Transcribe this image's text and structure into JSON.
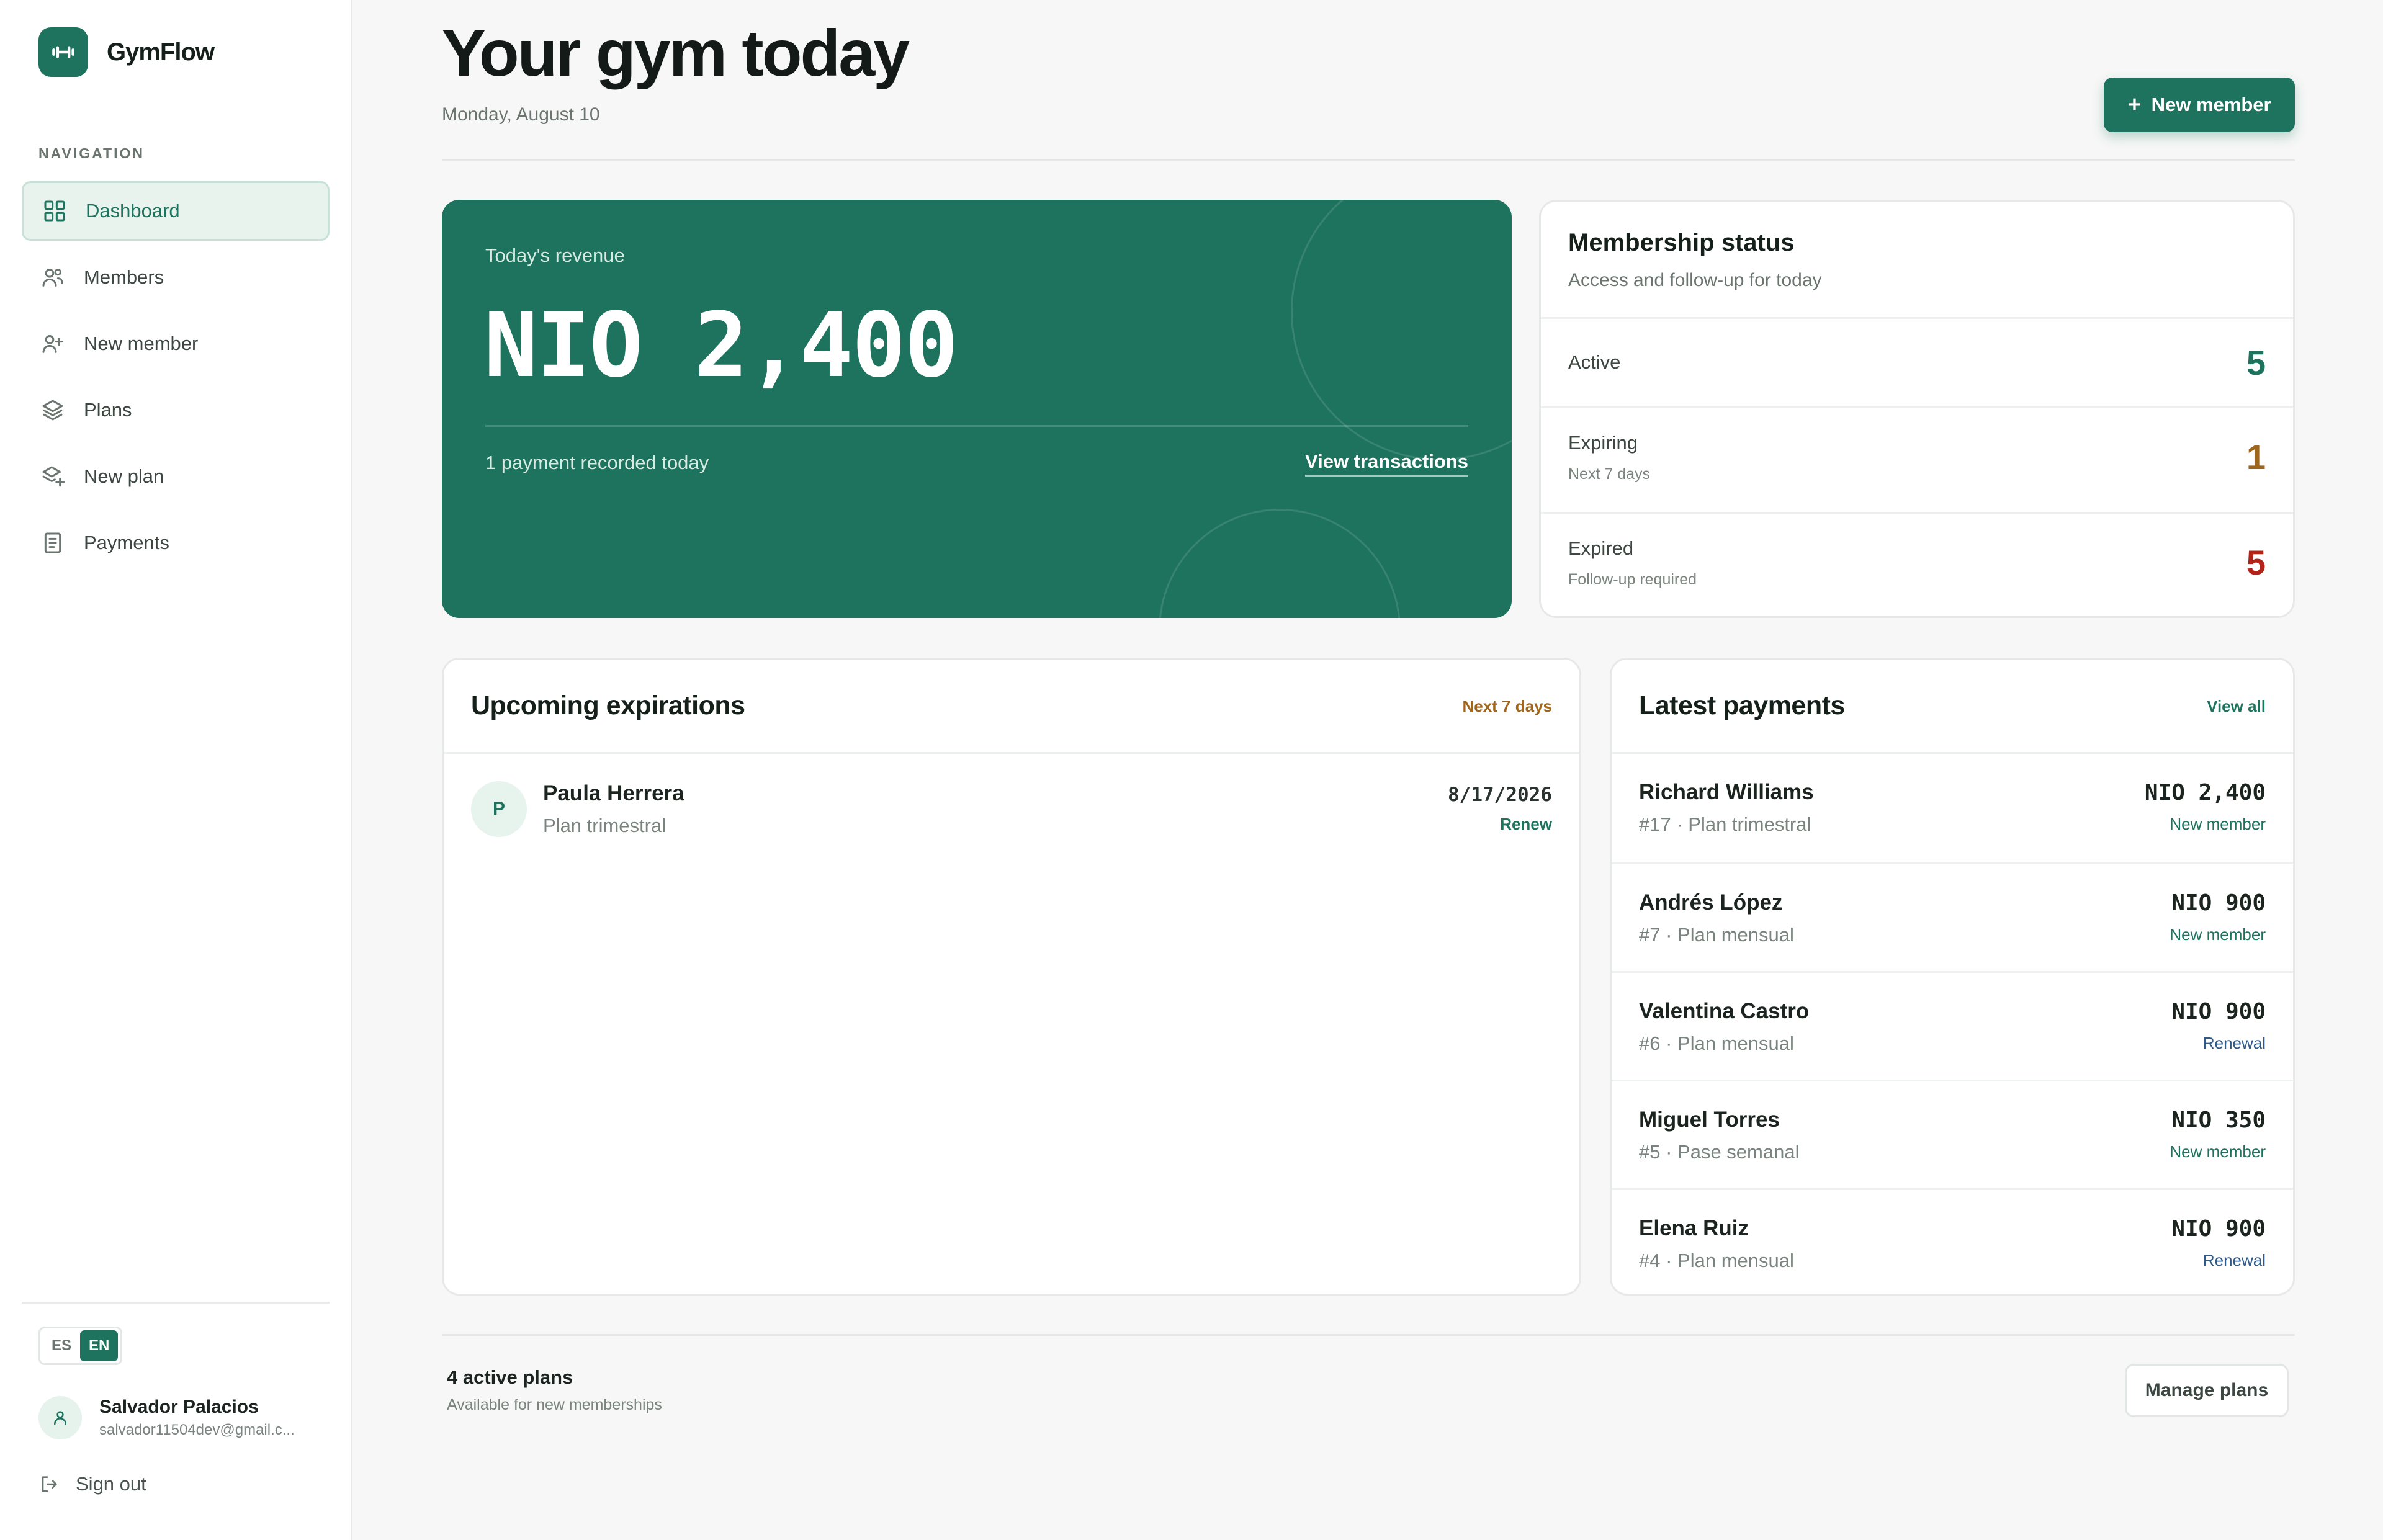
{
  "app": {
    "name": "GymFlow"
  },
  "sidebar": {
    "heading": "NAVIGATION",
    "items": [
      {
        "label": "Dashboard",
        "icon": "grid-icon",
        "active": true
      },
      {
        "label": "Members",
        "icon": "users-icon"
      },
      {
        "label": "New member",
        "icon": "user-plus-icon"
      },
      {
        "label": "Plans",
        "icon": "layers-icon"
      },
      {
        "label": "New plan",
        "icon": "layers-plus-icon"
      },
      {
        "label": "Payments",
        "icon": "receipt-icon"
      }
    ],
    "languages": [
      "ES",
      "EN"
    ],
    "selected_language": "EN",
    "user": {
      "name": "Salvador Palacios",
      "email": "salvador11504dev@gmail.c..."
    },
    "sign_out": "Sign out"
  },
  "header": {
    "title": "Your gym today",
    "date": "Monday, August 10",
    "new_member_button": "New member"
  },
  "revenue": {
    "label": "Today's revenue",
    "amount": "NIO 2,400",
    "sub": "1 payment recorded today",
    "link": "View transactions"
  },
  "membership_status": {
    "title": "Membership status",
    "subtitle": "Access and follow-up for today",
    "rows": [
      {
        "label": "Active",
        "hint": "",
        "value": "5",
        "color": "#1d735e"
      },
      {
        "label": "Expiring",
        "hint": "Next 7 days",
        "value": "1",
        "color": "#a0661c"
      },
      {
        "label": "Expired",
        "hint": "Follow-up required",
        "value": "5",
        "color": "#b42318"
      }
    ]
  },
  "expirations": {
    "title": "Upcoming expirations",
    "tag": "Next 7 days",
    "items": [
      {
        "initial": "P",
        "name": "Paula Herrera",
        "plan": "Plan trimestral",
        "date": "8/17/2026",
        "action": "Renew"
      }
    ]
  },
  "payments": {
    "title": "Latest payments",
    "view_all": "View all",
    "items": [
      {
        "name": "Richard Williams",
        "detail": "#17 · Plan trimestral",
        "amount": "NIO 2,400",
        "kind": "New member"
      },
      {
        "name": "Andrés López",
        "detail": "#7 · Plan mensual",
        "amount": "NIO 900",
        "kind": "New member"
      },
      {
        "name": "Valentina Castro",
        "detail": "#6 · Plan mensual",
        "amount": "NIO 900",
        "kind": "Renewal"
      },
      {
        "name": "Miguel Torres",
        "detail": "#5 · Pase semanal",
        "amount": "NIO 350",
        "kind": "New member"
      },
      {
        "name": "Elena Ruiz",
        "detail": "#4 · Plan mensual",
        "amount": "NIO 900",
        "kind": "Renewal"
      }
    ]
  },
  "plans": {
    "count": "4 active plans",
    "sub": "Available for new memberships",
    "manage_button": "Manage plans"
  },
  "colors": {
    "brand": "#1d735e",
    "warning": "#a0661c",
    "danger": "#b42318",
    "renewal": "#2f5a8a"
  }
}
